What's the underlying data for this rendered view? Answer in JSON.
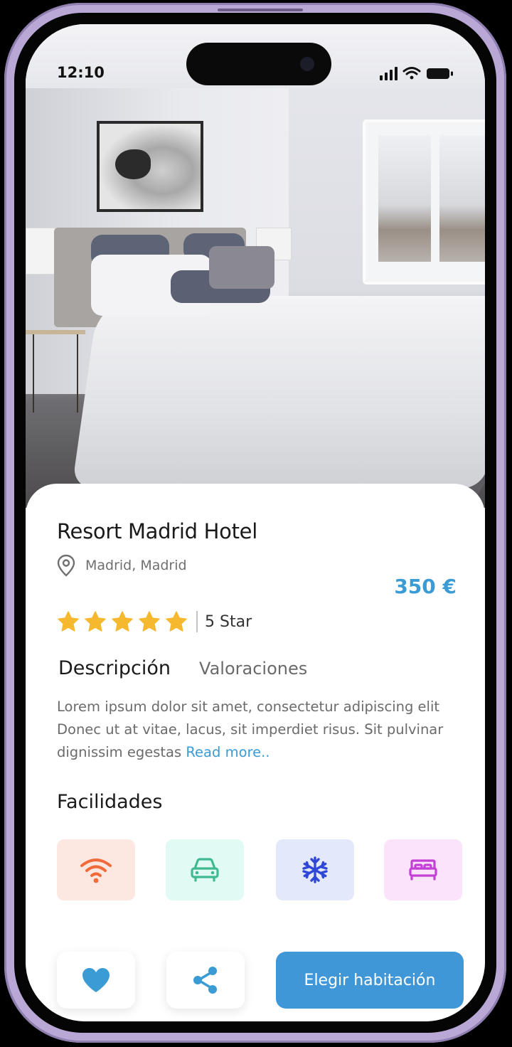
{
  "status_bar": {
    "time": "12:10"
  },
  "hotel": {
    "name": "Resort Madrid Hotel",
    "location": "Madrid, Madrid",
    "price": "350 €",
    "rating_stars": 5,
    "rating_label": "5 Star"
  },
  "tabs": [
    {
      "label": "Descripción",
      "active": true
    },
    {
      "label": "Valoraciones",
      "active": false
    }
  ],
  "description": {
    "text": "Lorem ipsum dolor sit amet, consectetur adipiscing elit Donec ut at vitae, lacus, sit imperdiet risus. Sit pulvinar dignissim egestas",
    "read_more": "Read more.."
  },
  "facilities": {
    "title": "Facilidades",
    "items": [
      {
        "icon": "wifi-icon",
        "bg": "#fde8e1",
        "color": "#f06a3a"
      },
      {
        "icon": "car-icon",
        "bg": "#e1fbf4",
        "color": "#3fb98f"
      },
      {
        "icon": "snowflake-icon",
        "bg": "#e4e8fb",
        "color": "#2f47d6"
      },
      {
        "icon": "bed-icon",
        "bg": "#fbe4fb",
        "color": "#c33fd6"
      }
    ]
  },
  "actions": {
    "favorite_icon": "heart-icon",
    "share_icon": "share-icon",
    "cta_label": "Elegir habitación"
  },
  "colors": {
    "accent": "#3a9bd5",
    "star": "#f5b82e",
    "cta_bg": "#3f97d8"
  }
}
